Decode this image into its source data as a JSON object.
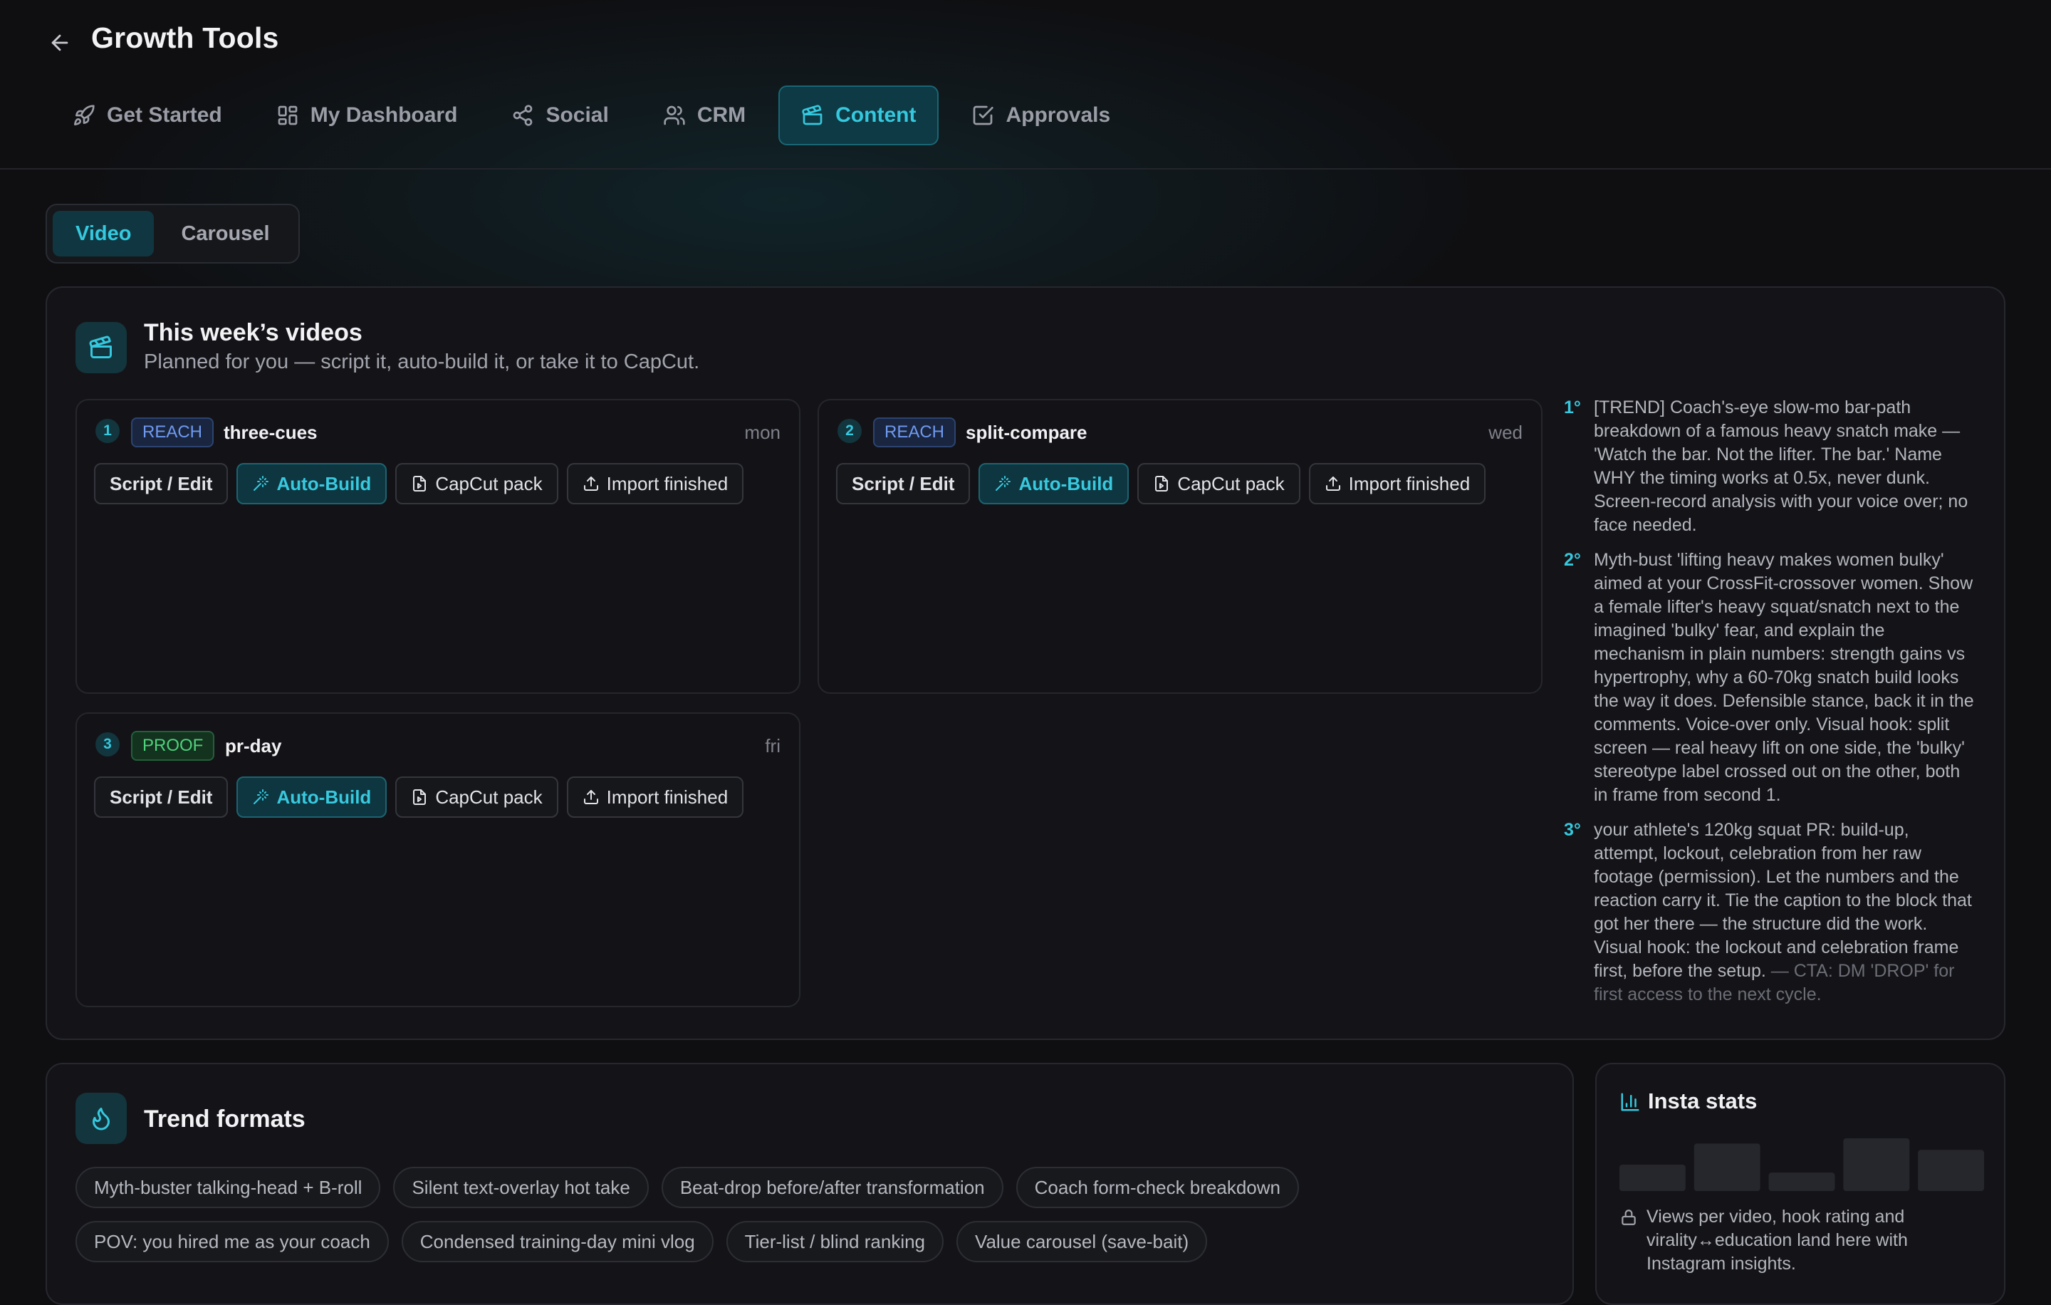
{
  "header": {
    "title": "Growth Tools",
    "tabs": [
      {
        "label": "Get Started",
        "icon": "rocket-icon"
      },
      {
        "label": "My Dashboard",
        "icon": "grid-icon"
      },
      {
        "label": "Social",
        "icon": "share-icon"
      },
      {
        "label": "CRM",
        "icon": "users-icon"
      },
      {
        "label": "Content",
        "icon": "clapperboard-icon",
        "active": true
      },
      {
        "label": "Approvals",
        "icon": "check-square-icon"
      }
    ]
  },
  "content_tabs": {
    "items": [
      {
        "label": "Video",
        "active": true
      },
      {
        "label": "Carousel",
        "active": false
      }
    ]
  },
  "videos_panel": {
    "title": "This week’s videos",
    "subtitle": "Planned for you — script it, auto-build it, or take it to CapCut.",
    "buttons": {
      "script": "Script / Edit",
      "auto_build": "Auto-Build",
      "capcut": "CapCut pack",
      "import": "Import finished"
    },
    "cards": [
      {
        "number": "1",
        "tag": "REACH",
        "slug": "three-cues",
        "day": "mon"
      },
      {
        "number": "2",
        "tag": "REACH",
        "slug": "split-compare",
        "day": "wed"
      },
      {
        "number": "3",
        "tag": "PROOF",
        "slug": "pr-day",
        "day": "fri"
      }
    ],
    "ideas": [
      {
        "rank": "1°",
        "text": "[TREND] Coach's-eye slow-mo bar-path breakdown of a famous heavy snatch make — 'Watch the bar. Not the lifter. The bar.' Name WHY the timing works at 0.5x, never dunk. Screen-record analysis with your voice over; no face needed.",
        "cta": ""
      },
      {
        "rank": "2°",
        "text": "Myth-bust 'lifting heavy makes women bulky' aimed at your CrossFit-crossover women. Show a female lifter's heavy squat/snatch next to the imagined 'bulky' fear, and explain the mechanism in plain numbers: strength gains vs hypertrophy, why a 60-70kg snatch build looks the way it does. Defensible stance, back it in the comments. Voice-over only. Visual hook: split screen — real heavy lift on one side, the 'bulky' stereotype label crossed out on the other, both in frame from second 1.",
        "cta": ""
      },
      {
        "rank": "3°",
        "text": "your athlete's 120kg squat PR: build-up, attempt, lockout, celebration from her raw footage (permission). Let the numbers and the reaction carry it. Tie the caption to the block that got her there — the structure did the work. Visual hook: the lockout and celebration frame first, before the setup.",
        "cta": " — CTA: DM 'DROP' for first access to the next cycle."
      }
    ]
  },
  "trend_panel": {
    "title": "Trend formats",
    "chips": [
      "Myth-buster talking-head + B-roll",
      "Silent text-overlay hot take",
      "Beat-drop before/after transformation",
      "Coach form-check breakdown",
      "POV: you hired me as your coach",
      "Condensed training-day mini vlog",
      "Tier-list / blind ranking",
      "Value carousel (save-bait)"
    ]
  },
  "stats_panel": {
    "title": "Insta stats",
    "note": "Views per video, hook rating and virality↔education land here with Instagram insights.",
    "placeholder_levels": [
      0.5,
      0.9,
      0.35,
      1.0,
      0.78
    ]
  },
  "colors": {
    "accent": "#35c8de",
    "reach": "#6f9af0",
    "proof": "#4fd27c",
    "background": "#0f0f12"
  }
}
